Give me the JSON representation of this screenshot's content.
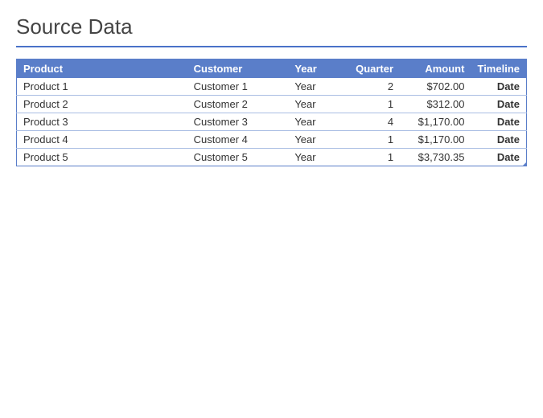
{
  "title": "Source Data",
  "headers": {
    "product": "Product",
    "customer": "Customer",
    "year": "Year",
    "quarter": "Quarter",
    "amount": "Amount",
    "timeline": "Timeline"
  },
  "rows": [
    {
      "product": "Product 1",
      "customer": "Customer 1",
      "year": "Year",
      "quarter": "2",
      "amount": "$702.00",
      "timeline": "Date"
    },
    {
      "product": "Product 2",
      "customer": "Customer 2",
      "year": "Year",
      "quarter": "1",
      "amount": "$312.00",
      "timeline": "Date"
    },
    {
      "product": "Product 3",
      "customer": "Customer 3",
      "year": "Year",
      "quarter": "4",
      "amount": "$1,170.00",
      "timeline": "Date"
    },
    {
      "product": "Product 4",
      "customer": "Customer 4",
      "year": "Year",
      "quarter": "1",
      "amount": "$1,170.00",
      "timeline": "Date"
    },
    {
      "product": "Product 5",
      "customer": "Customer 5",
      "year": "Year",
      "quarter": "1",
      "amount": "$3,730.35",
      "timeline": "Date"
    }
  ]
}
